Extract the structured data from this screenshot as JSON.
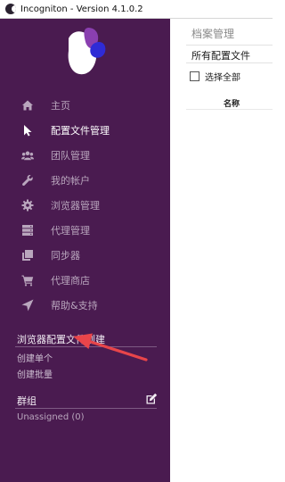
{
  "window": {
    "title": "Incogniton - Version 4.1.0.2"
  },
  "sidebar": {
    "nav": [
      {
        "label": "主页",
        "icon": "home-icon",
        "active": false
      },
      {
        "label": "配置文件管理",
        "icon": "cursor-icon",
        "active": true
      },
      {
        "label": "团队管理",
        "icon": "team-icon",
        "active": false
      },
      {
        "label": "我的帐户",
        "icon": "wrench-icon",
        "active": false
      },
      {
        "label": "浏览器管理",
        "icon": "gear-icon",
        "active": false
      },
      {
        "label": "代理管理",
        "icon": "server-icon",
        "active": false
      },
      {
        "label": "同步器",
        "icon": "sync-icon",
        "active": false
      },
      {
        "label": "代理商店",
        "icon": "cart-icon",
        "active": false
      },
      {
        "label": "帮助&支持",
        "icon": "send-icon",
        "active": false
      }
    ],
    "profile_creation": {
      "title": "浏览器配置文件创建",
      "create_single": "创建单个",
      "create_batch": "创建批量"
    },
    "groups": {
      "title": "群组",
      "unassigned": "Unassigned (0)"
    }
  },
  "main": {
    "title": "档案管理",
    "all_profiles": "所有配置文件",
    "select_all": "选择全部",
    "columns": [
      "名称"
    ]
  },
  "colors": {
    "sidebar_bg": "#4a1b50",
    "arrow": "#e8454a",
    "logo_purple": "#8a3fb0",
    "logo_blue": "#2f2bd6"
  }
}
